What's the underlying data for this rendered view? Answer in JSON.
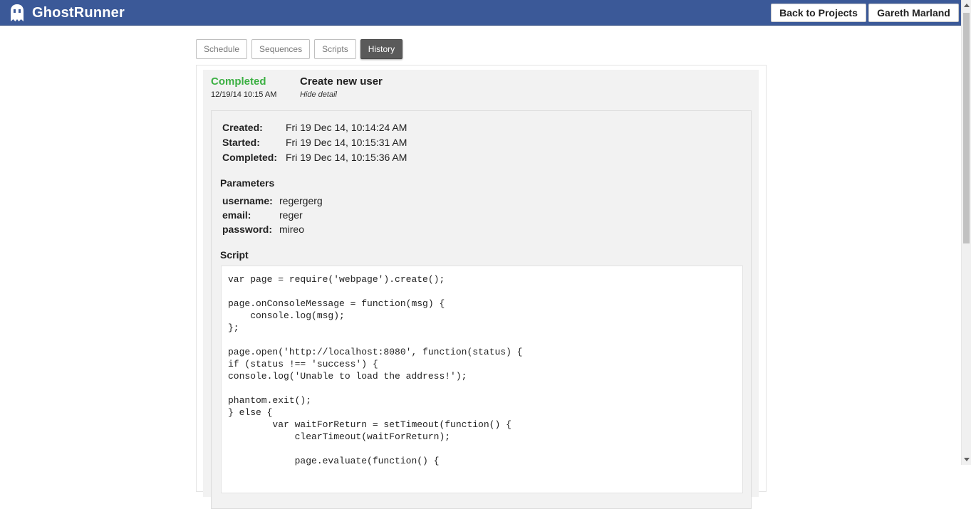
{
  "app": {
    "title": "GhostRunner"
  },
  "header": {
    "back_label": "Back to Projects",
    "user_label": "Gareth Marland"
  },
  "tabs": [
    {
      "label": "Schedule",
      "active": false
    },
    {
      "label": "Sequences",
      "active": false
    },
    {
      "label": "Scripts",
      "active": false
    },
    {
      "label": "History",
      "active": true
    }
  ],
  "run": {
    "status": "Completed",
    "date": "12/19/14 10:15 AM",
    "name": "Create new user",
    "toggle_label": "Hide detail",
    "status_color": "#3cb043"
  },
  "detail": {
    "times": [
      {
        "label": "Created:",
        "value": "Fri 19 Dec 14, 10:14:24 AM"
      },
      {
        "label": "Started:",
        "value": "Fri 19 Dec 14, 10:15:31 AM"
      },
      {
        "label": "Completed:",
        "value": "Fri 19 Dec 14, 10:15:36 AM"
      }
    ],
    "parameters_title": "Parameters",
    "parameters": [
      {
        "label": "username:",
        "value": "regergerg"
      },
      {
        "label": "email:",
        "value": "reger"
      },
      {
        "label": "password:",
        "value": "mireo"
      }
    ],
    "script_title": "Script",
    "script": "var page = require('webpage').create();\n\npage.onConsoleMessage = function(msg) {\n    console.log(msg);\n};\n\npage.open('http://localhost:8080', function(status) {\nif (status !== 'success') {\nconsole.log('Unable to load the address!');\n\nphantom.exit();\n} else {\n        var waitForReturn = setTimeout(function() {\n            clearTimeout(waitForReturn);\n\n            page.evaluate(function() {"
  },
  "colors": {
    "header_bg": "#3b5998",
    "active_tab_bg": "#5a5a5a"
  }
}
